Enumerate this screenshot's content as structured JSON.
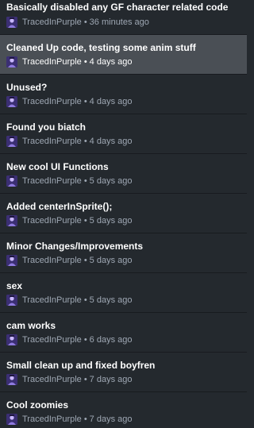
{
  "commits": [
    {
      "summary": "Basically disabled any GF character related code",
      "author": "TracedInPurple",
      "time": "36 minutes ago"
    },
    {
      "summary": "Cleaned Up code, testing some anim stuff",
      "author": "TracedInPurple",
      "time": "4 days ago"
    },
    {
      "summary": "Unused?",
      "author": "TracedInPurple",
      "time": "4 days ago"
    },
    {
      "summary": "Found you biatch",
      "author": "TracedInPurple",
      "time": "4 days ago"
    },
    {
      "summary": "New cool UI Functions",
      "author": "TracedInPurple",
      "time": "5 days ago"
    },
    {
      "summary": "Added centerInSprite();",
      "author": "TracedInPurple",
      "time": "5 days ago"
    },
    {
      "summary": "Minor Changes/Improvements",
      "author": "TracedInPurple",
      "time": "5 days ago"
    },
    {
      "summary": "sex",
      "author": "TracedInPurple",
      "time": "5 days ago"
    },
    {
      "summary": "cam works",
      "author": "TracedInPurple",
      "time": "6 days ago"
    },
    {
      "summary": "Small clean up and fixed boyfren",
      "author": "TracedInPurple",
      "time": "7 days ago"
    },
    {
      "summary": "Cool zoomies",
      "author": "TracedInPurple",
      "time": "7 days ago"
    }
  ],
  "separator": "•",
  "avatar_icon": "user-avatar-icon",
  "colors": {
    "background": "#24292e",
    "selected_background": "#4a4f55",
    "summary_text": "#ffffff",
    "meta_text": "#9ea7b3",
    "divider": "#181b1f"
  }
}
